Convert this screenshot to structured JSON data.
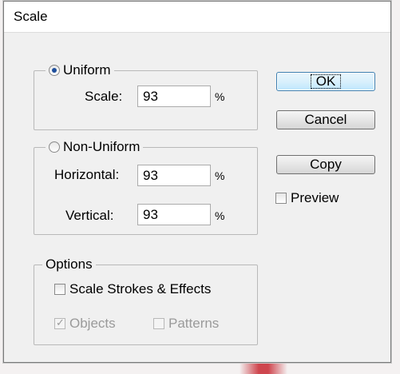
{
  "dialog": {
    "title": "Scale"
  },
  "uniform": {
    "label": "Uniform",
    "selected": true,
    "scale_label": "Scale:",
    "scale_value": "93",
    "unit": "%"
  },
  "non_uniform": {
    "label": "Non-Uniform",
    "selected": false,
    "horizontal_label": "Horizontal:",
    "horizontal_value": "93",
    "vertical_label": "Vertical:",
    "vertical_value": "93",
    "unit": "%"
  },
  "options": {
    "label": "Options",
    "scale_strokes_label": "Scale Strokes & Effects",
    "scale_strokes_checked": false,
    "objects_label": "Objects",
    "objects_checked": true,
    "objects_enabled": false,
    "patterns_label": "Patterns",
    "patterns_checked": false,
    "patterns_enabled": false
  },
  "buttons": {
    "ok": "OK",
    "cancel": "Cancel",
    "copy": "Copy"
  },
  "preview": {
    "label": "Preview",
    "checked": false
  }
}
